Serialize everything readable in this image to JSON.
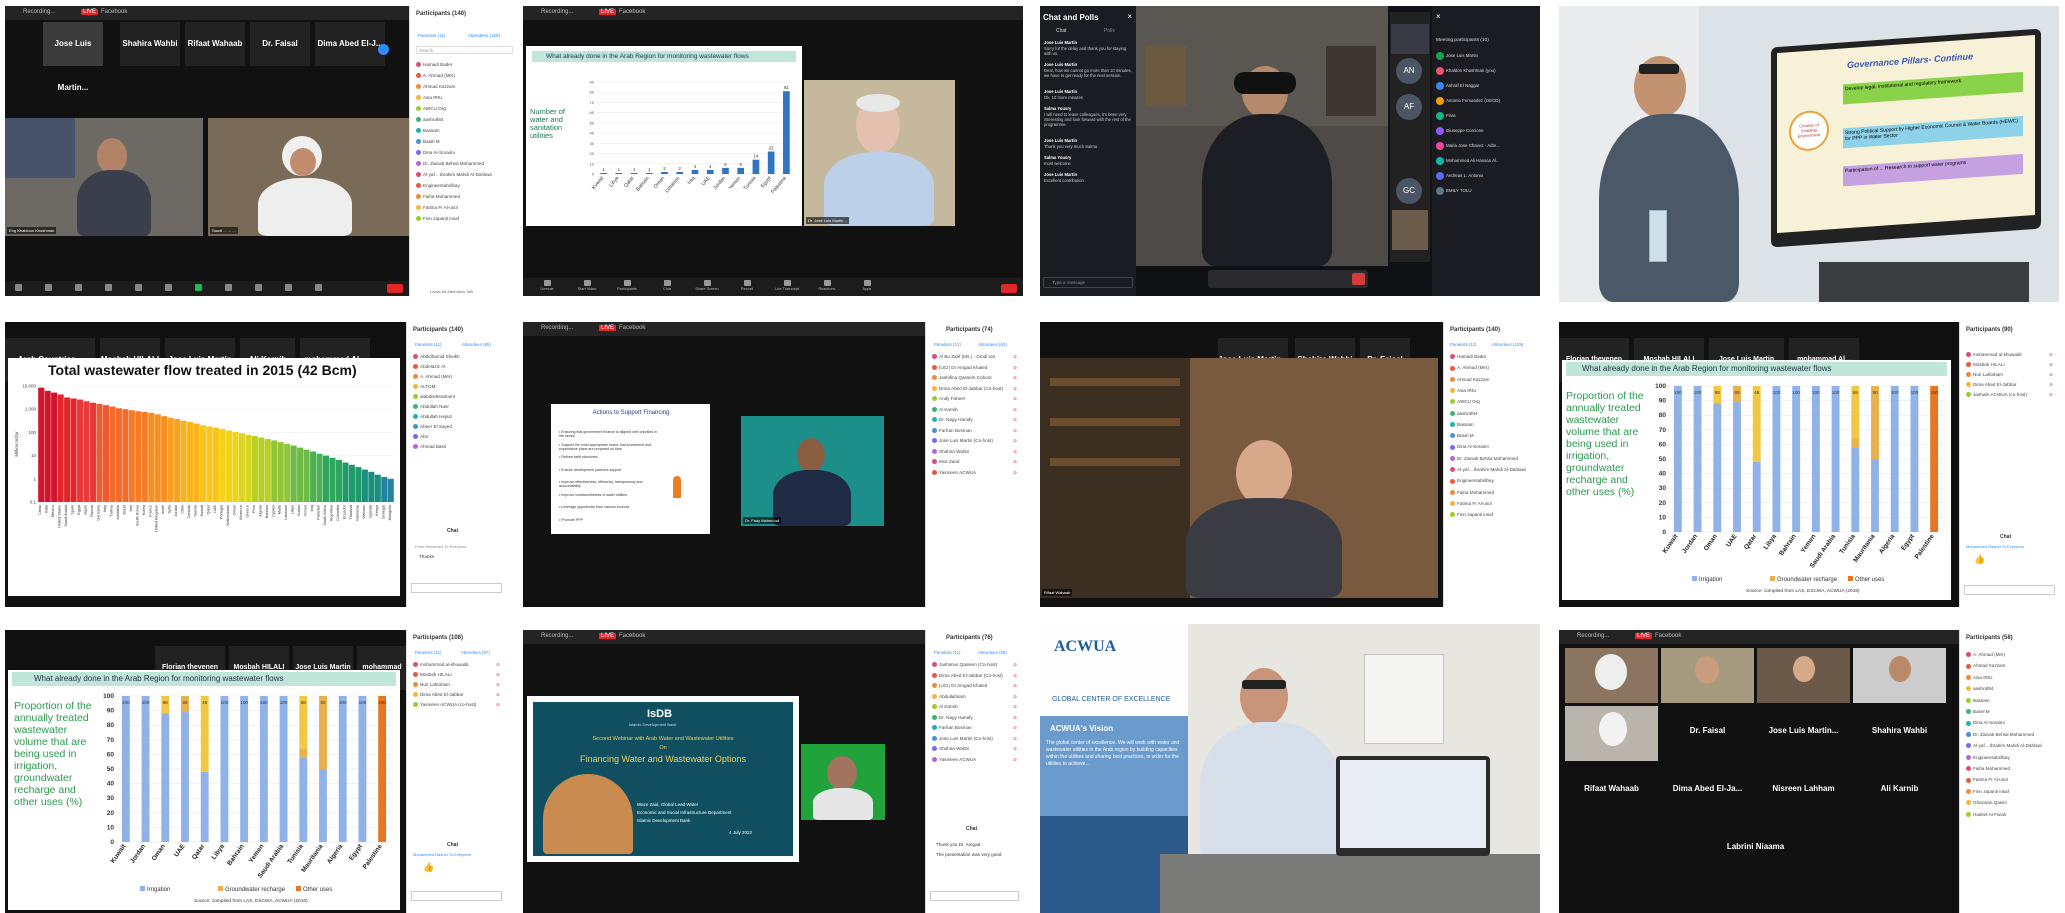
{
  "tiles": {
    "t1": {
      "app_title": "Zoom Webinar",
      "recording": "Recording...",
      "live": "LIVE",
      "facebook": "Facebook",
      "popout": "Pop",
      "thumbs": [
        "Jose Luis Martin...",
        "Shahira Wahbi",
        "Rifaat Wahaab",
        "Dr. Faisal",
        "Dima Abed El-J..."
      ],
      "thumb_captions": [
        "Jose Luis Martin Ab...",
        "Shahira Wahbi Lahmar...",
        "Rifaat Wahaab",
        "Dr. Faisal",
        "Dima Abed El-Jabbar"
      ],
      "video_captions": [
        "Eng Khaldoun Khashman",
        "Saudi ... ... ..."
      ],
      "panel_title": "Participants (140)",
      "panel_tabs": [
        "Panelists (11)",
        "Attendees (129)"
      ],
      "search": "Search",
      "rows": [
        "Hamadi Bader",
        "A. Ahmad (Mrs)",
        "Ahmad Kazzam",
        "Asia IRIU",
        "AWCU Org",
        "aashraf84",
        "Bassam",
        "Basel M",
        "Dina Al-Soraimi",
        "Dr. Zainab Behsa Mohammed",
        "Al-yaf... Ibrahim Mahdi Al-Dahlawi",
        "Engineersabrilbay",
        "Faiha Mohammed",
        "Fatima Fr Al-usol",
        "Finn zapanti insaf"
      ],
      "more": "Leave All Attendees Talk"
    },
    "t2": {
      "slide_title": "What already done in the Arab Region for monitoring wastewater flows",
      "chart_text": "Number of water and sanitation utilities",
      "categories": [
        "Kuwait",
        "Libya",
        "Qatar",
        "Bahrain",
        "Oman",
        "Lebanon",
        "Iraq",
        "UAE",
        "Jordan",
        "Yemen",
        "Tunisia",
        "Egypt",
        "Palestine"
      ],
      "values": [
        1,
        1,
        1,
        1,
        2,
        2,
        4,
        4,
        6,
        6,
        14,
        22,
        81
      ],
      "video_caption": "Dr. Jose Luis Martin...",
      "toolbar": [
        "Unmute",
        "Start Video",
        "Participants",
        "Chat",
        "Share Screen",
        "Record",
        "Live Transcript",
        "Reactions",
        "Apps",
        "End"
      ]
    },
    "t3": {
      "chat_heading": "Chat and Polls",
      "chat_tabs": [
        "Chat",
        "Polls"
      ],
      "messages": [
        {
          "name": "Jose Luis Martin",
          "text": "Sorry for the delay and thank you for staying with us."
        },
        {
          "name": "Jose Luis Martin",
          "text": "Dear, how we cannot go more than 10 minutes, we have to get ready for the next session."
        },
        {
          "name": "Jose Luis Martin",
          "text": "Ok, 10 more minutes"
        },
        {
          "name": "Salma Yousry",
          "text": "I will need to leave colleagues, it's been very interesting and look forward with the rest of the programme."
        },
        {
          "name": "Jose Luis Martin",
          "text": "Thank you very much Salma"
        },
        {
          "name": "Salma Yousry",
          "text": "most welcome"
        },
        {
          "name": "Jose Luis Martin",
          "text": "Excellent contribution"
        }
      ],
      "chat_input": "Type a message",
      "avatars": [
        "AN",
        "AF",
        "GC"
      ],
      "right_heading": "Meeting participants (10)",
      "participants": [
        "Jose Luis Martin",
        "Khaldon Khashman (you)",
        "Ashraf El Naggar",
        "Antonio Fernandez (OECD)",
        "Firas",
        "Giuseppe Corcione",
        "Maria Jose Chavez - Adm...",
        "Mohammed Ali Hassan Al..",
        "Andreas L. Antonio",
        "EMILY TOLU"
      ]
    },
    "t4": {
      "slide_title": "Governance Pillars- Continue",
      "slide_center": "Creation of Enabling Environment",
      "items": [
        "Develop legal, institutional and regulatory framework",
        "Strong Political Support by Higher Economic Council & Water Boards (HEWC) for PPP in Water Sector",
        "Participation of ... Research to support water programs"
      ]
    },
    "t5": {
      "thumbs": [
        "Arab Countries...",
        "Mosbah HILALI",
        "Jose Luis Martin",
        "Ali Karnib",
        "mohammad Al..."
      ],
      "chart_title": "Total wastewater flow treated in 2015 (42 Bcm)",
      "ylabel": "Million m3/yr",
      "yticks": [
        "10,000",
        "1,000",
        "100",
        "10",
        "1",
        "0.1"
      ],
      "categories": [
        "China",
        "India",
        "Mexico",
        "United States",
        "Saudi Arabia",
        "Spain",
        "Egypt",
        "Japan",
        "Russia",
        "Germany",
        "Italy",
        "Turkey",
        "Australia",
        "Brazil",
        "Iran",
        "South Korea",
        "Korea",
        "France",
        "United Kingdom",
        "Israel",
        "Syria",
        "Jordan",
        "Chile",
        "Canada",
        "Tunisia",
        "Kuwait",
        "Qatar",
        "UAE",
        "Portugal",
        "Netherlands",
        "Oman",
        "Morocco",
        "Greece",
        "Peru",
        "Algeria",
        "Bahrain",
        "Cyprus",
        "Malta",
        "Lebanon",
        "Libya",
        "Sudan",
        "Yemen",
        "Iraq",
        "Pakistan",
        "South Africa",
        "Argentina",
        "Colombia",
        "Ecuador",
        "Thailand",
        "Indonesia",
        "Vietnam",
        "Uganda",
        "Kenya",
        "Senegal",
        "Mongolia"
      ],
      "values": [
        8500,
        6200,
        5200,
        4300,
        3200,
        2900,
        2600,
        2200,
        1900,
        1700,
        1500,
        1300,
        1100,
        1000,
        900,
        820,
        760,
        700,
        600,
        500,
        430,
        380,
        320,
        280,
        240,
        200,
        180,
        160,
        140,
        120,
        105,
        92,
        80,
        70,
        60,
        52,
        45,
        38,
        32,
        27,
        22,
        18,
        15,
        12,
        10,
        8,
        6.5,
        5,
        4,
        3.2,
        2.5,
        2,
        1.5,
        1.2,
        1
      ],
      "panel_title": "Participants (140)",
      "panel_tabs": [
        "Panelists (11)",
        "Attendees (85)"
      ],
      "rows": [
        "Abdelhamid Sheikh",
        "Abdelaziz Al",
        "A. Ahmad (Mrs)",
        "ALTOM",
        "alabdiwtreatment",
        "Abdullah Nasr",
        "Abdullah Hejazi",
        "Abeer El Sayed",
        "Abir",
        "Ahmad Bakri"
      ],
      "chat_label": "Chat",
      "chat_msg": "Thanks",
      "chat_from": "From Mohamed To Everyone"
    },
    "t6": {
      "slide_title": "Actions to Support Financing",
      "bullets": [
        "Ensuring that government finance is aligned with priorities in the sector",
        "Support the most appropriate sector that investment and expenditure plans are prepared on time",
        "Reform tariff structures",
        "Ensure development partners support",
        "Improve effectiveness, efficiency, transparency and accountability",
        "Improve creditworthiness of water utilities",
        "Leverage opportunity from various sources",
        "Promote PPP"
      ],
      "video_caption": "Dr. Fady Mahmoud",
      "panel_title": "Participants (74)",
      "panel_tabs": [
        "Panelists (12)",
        "Attendees (62)"
      ],
      "rows": [
        "Al Bu Zarif (Ms.) - Omdi Var",
        "(UCI) Dr Amgad Khaled",
        "Jashifina Qassem Cohoot",
        "Drina Abed El-Jabbar (Co-host)",
        "Andy Faheer",
        "Al Karnib",
        "Dr. Nagy Hanafy",
        "Farhan Bosman",
        "Jose Luis Martin (Co-host)",
        "Shahira Wahbi",
        "Mos Zand",
        "Yasmeen ACWUA"
      ]
    },
    "t7": {
      "thumbs": [
        "Jose Luis Martin...",
        "Shahira Wahbi",
        "Dr. Faisal"
      ],
      "panel_title": "Participants (140)",
      "panel_tabs": [
        "Panelists (11)",
        "Attendees (129)"
      ],
      "rows": [
        "Hamadi Bader",
        "A. Ahmad (Mrs)",
        "Ahmad Kazzam",
        "Asia IRIU",
        "AWCU Org",
        "aashraf84",
        "Bassam",
        "Basel M",
        "Dina Al-Soraimi",
        "Dr. Zainab Behsa Mohammed",
        "Al-yaf... Ibrahim Mahdi Al-Dahlawi",
        "Engineersabrilbay",
        "Faiha Mohammed",
        "Fatima Fr Al-usol",
        "Finn zapanti insaf"
      ],
      "video_caption": "Rifaat Wahaab"
    },
    "t8": {
      "thumbs": [
        "Florian thevenen",
        "Mosbah HILALI",
        "Jose Luis Martin",
        "mohammad Al..."
      ],
      "slide_title": "What already done in the Arab Region for monitoring wastewater flows",
      "side_text": "Proportion of the annually treated wastewater volume that are being used in irrigation, groundwater recharge and other uses (%)",
      "legend": [
        "Irrigation",
        "Groundwater recharge",
        "Other uses"
      ],
      "source": "Source: compiled from LAS, ESCWA, ACWUA (2016)",
      "panel_title": "Participants (90)",
      "rows": [
        "mohammad al-khuwaldi",
        "Mosbah HILALI",
        "Nuri Lahlaham",
        "Dima Abed El-Jabbar",
        "Jashwin ACWUA (co-host)"
      ],
      "chat_label": "Chat",
      "chat_from": "Mohammed Rashid To Everyone"
    },
    "t9": {
      "thumbs": [
        "Florian thevenen",
        "Mosbah HILALI",
        "Jose Luis Martin",
        "mohammad Al..."
      ],
      "slide_title": "What already done in the Arab Region for monitoring wastewater flows",
      "side_text": "Proportion of the annually treated wastewater volume that are being used in irrigation, groundwater recharge and other uses (%)",
      "legend": [
        "Irrigation",
        "Groundwater recharge",
        "Other uses"
      ],
      "source": "Source: compiled from LAS, ESCWA, ACWUA (2016)",
      "panel_title": "Participants (108)",
      "panel_tabs": [
        "Panelists (11)",
        "Attendees (97)"
      ],
      "rows": [
        "mohammad al-khuwaldi",
        "Mosbah HILALI",
        "Nuri Lahlaham",
        "Dima Abed El-Jabbar",
        "Yasmeen ACWUA (co-host)"
      ],
      "chat_label": "Chat",
      "chat_from": "Mohammed Rashid To Everyone"
    },
    "t10": {
      "brand": "IsDB",
      "brand_sub": "Islamic Development Bank",
      "line1": "Second Webinar with Arab Water and Wastewater Utilities",
      "line2": "On",
      "line3": "Financing Water and Wastewater Options",
      "presenter": "Waze Zaid, Global Lead Water",
      "presenter2": "Economic and Social Infrastructure Department",
      "presenter3": "Islamic Development Bank",
      "date": "4 July 2022",
      "panel_title": "Participants (76)",
      "panel_tabs": [
        "Panelists (11)",
        "Attendees (65)"
      ],
      "rows": [
        "Jashimus Qassem (Co-host)",
        "Dima Abed El-Jabbar (Co-host)",
        "(UCI) Dr Amgad Khaled",
        "Abdullahsam",
        "Al Karnib",
        "Dr. Nagy Hanafy",
        "Farhan Bosman",
        "Jose Luis Martin (Co-host)",
        "Shahira Wahbi",
        "Yasmeen ACWUA"
      ],
      "chat_label": "Chat",
      "chat_msg": "Thank you Dr. Amgad",
      "chat_msg2": "The presentation was very good"
    },
    "t11": {
      "logo": "ACWUA",
      "banner_title": "ACWUA's Vision",
      "banner_text": "The global center of excellence. We will work with water and wastewater utilities in the Arab region by building capacities within the utilities and sharing best practices, in order for the utilities to achieve...",
      "side_text": "GLOBAL CENTER OF EXCELLENCE"
    },
    "t12": {
      "names": [
        "Dr. Faisal",
        "Jose Luis Martin...",
        "Shahira Wahbi",
        "Rifaat Wahaab",
        "Dima Abed El-Ja...",
        "Nisreen Lahham",
        "Ali Karnib",
        "Labrini Niaama"
      ],
      "panel_title": "Participants (58)",
      "rows": [
        "A. Ahmad (Mrs)",
        "Ahmad Kazzam",
        "Asia IRIU",
        "aashraf84",
        "Bassam",
        "Basel M",
        "Dina Al-Soraimi",
        "Dr. Zainab Behsa Mohammed",
        "Al-yaf... Ibrahim Mahdi Al-Dahlawi",
        "Engineersabrilbay",
        "Faiha Mohammed",
        "Fatima Fr Al-usol",
        "Finn zapanti insaf",
        "Ghazwan Qasim",
        "Hadeel Al-Farah"
      ]
    }
  },
  "bars_t8": {
    "categories": [
      "Kuwait",
      "Jordan",
      "Oman",
      "UAE",
      "Qatar",
      "Libya",
      "Bahrain",
      "Yemen",
      "Saudi Arabia",
      "Tunisia",
      "Mauritania",
      "Algeria",
      "Egypt",
      "Palestine"
    ],
    "irrigation": [
      100,
      100,
      88,
      89,
      48,
      100,
      100,
      100,
      100,
      58,
      50,
      100,
      100,
      0
    ],
    "groundwater": [
      0,
      0,
      0,
      11,
      0,
      0,
      0,
      0,
      0,
      6,
      50,
      0,
      0,
      0
    ],
    "other": [
      0,
      0,
      12,
      0,
      52,
      0,
      0,
      0,
      0,
      36,
      0,
      0,
      0,
      100
    ],
    "labels": [
      "100",
      "100",
      "88",
      "89",
      "48",
      "100",
      "100",
      "100",
      "100",
      "58",
      "50",
      "100",
      "100",
      "100"
    ]
  },
  "colors": {
    "accent": "#2d8cff",
    "end": "#e02828",
    "slide_green": "#2e8b57",
    "irrigation": "#8fb3e8",
    "groundwater": "#e8b14b",
    "other": "#e87522"
  }
}
